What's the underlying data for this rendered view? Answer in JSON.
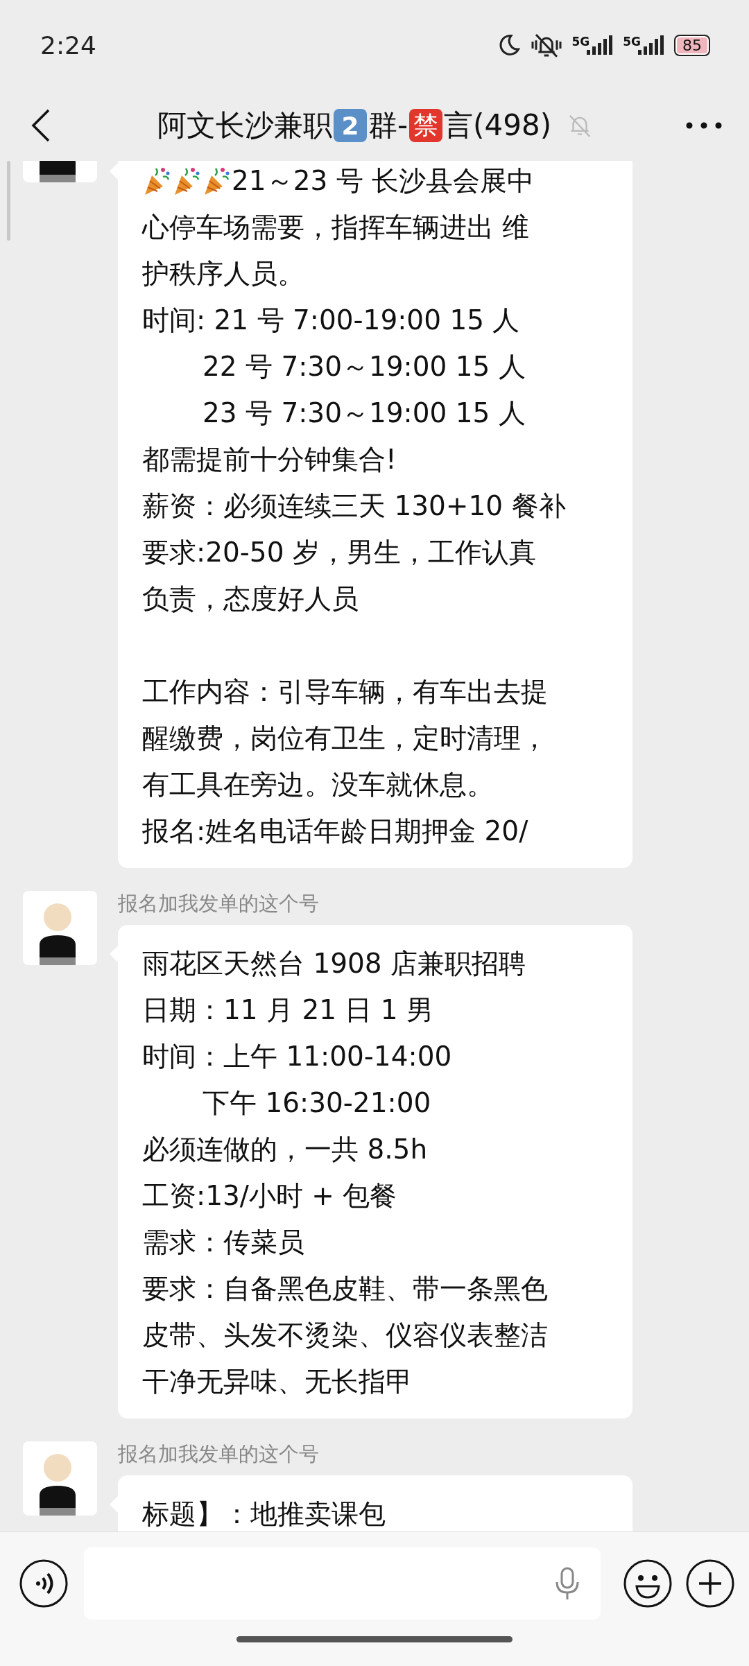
{
  "status_bar": {
    "time": "2:24",
    "networks": [
      "5G",
      "5G"
    ],
    "battery": "85"
  },
  "header": {
    "title": [
      {
        "kind": "text",
        "text": "阿文长沙兼职"
      },
      {
        "kind": "keycap",
        "text": "2"
      },
      {
        "kind": "text",
        "text": "群-"
      },
      {
        "kind": "badge",
        "text": "禁"
      },
      {
        "kind": "text",
        "text": "言(498)"
      }
    ],
    "muted": true
  },
  "messages": [
    {
      "lines": [
        {
          "kind": "celebration",
          "text": "21～23 号 长沙县会展中"
        },
        {
          "kind": "text",
          "text": "心停车场需要，指挥车辆进出 维"
        },
        {
          "kind": "text",
          "text": "护秩序人员。"
        },
        {
          "kind": "text",
          "text": "时间: 21 号 7:00-19:00  15 人"
        },
        {
          "kind": "indented",
          "text": "22 号 7:30～19:00  15 人"
        },
        {
          "kind": "indented",
          "text": "23 号 7:30～19:00  15 人"
        },
        {
          "kind": "text",
          "text": "都需提前十分钟集合!"
        },
        {
          "kind": "text",
          "text": "薪资：必须连续三天 130+10 餐补"
        },
        {
          "kind": "text",
          "text": "要求:20-50 岁，男生，工作认真"
        },
        {
          "kind": "text",
          "text": "负责，态度好人员"
        },
        {
          "kind": "blank"
        },
        {
          "kind": "text",
          "text": "工作内容：引导车辆，有车出去提"
        },
        {
          "kind": "text",
          "text": "醒缴费，岗位有卫生，定时清理，"
        },
        {
          "kind": "text",
          "text": "有工具在旁边。没车就休息。"
        },
        {
          "kind": "text",
          "text": "报名:姓名电话年龄日期押金 20/"
        }
      ]
    },
    {
      "sender": "报名加我发单的这个号",
      "lines": [
        {
          "kind": "text",
          "text": "雨花区天然台 1908 店兼职招聘"
        },
        {
          "kind": "text",
          "text": "日期：11 月 21 日  1 男"
        },
        {
          "kind": "text",
          "text": "时间：上午 11:00-14:00"
        },
        {
          "kind": "indented",
          "text": "下午 16:30-21:00"
        },
        {
          "kind": "text",
          "text": "必须连做的，一共 8.5h"
        },
        {
          "kind": "text",
          "text": "工资:13/小时 + 包餐"
        },
        {
          "kind": "text",
          "text": "需求：传菜员"
        },
        {
          "kind": "text",
          "text": "要求：自备黑色皮鞋、带一条黑色"
        },
        {
          "kind": "text",
          "text": "皮带、头发不烫染、仪容仪表整洁"
        },
        {
          "kind": "text",
          "text": "干净无异味、无长指甲"
        }
      ]
    },
    {
      "sender": "报名加我发单的这个号",
      "lines": [
        {
          "kind": "text",
          "text": "标题】：地推卖课包"
        }
      ]
    }
  ]
}
